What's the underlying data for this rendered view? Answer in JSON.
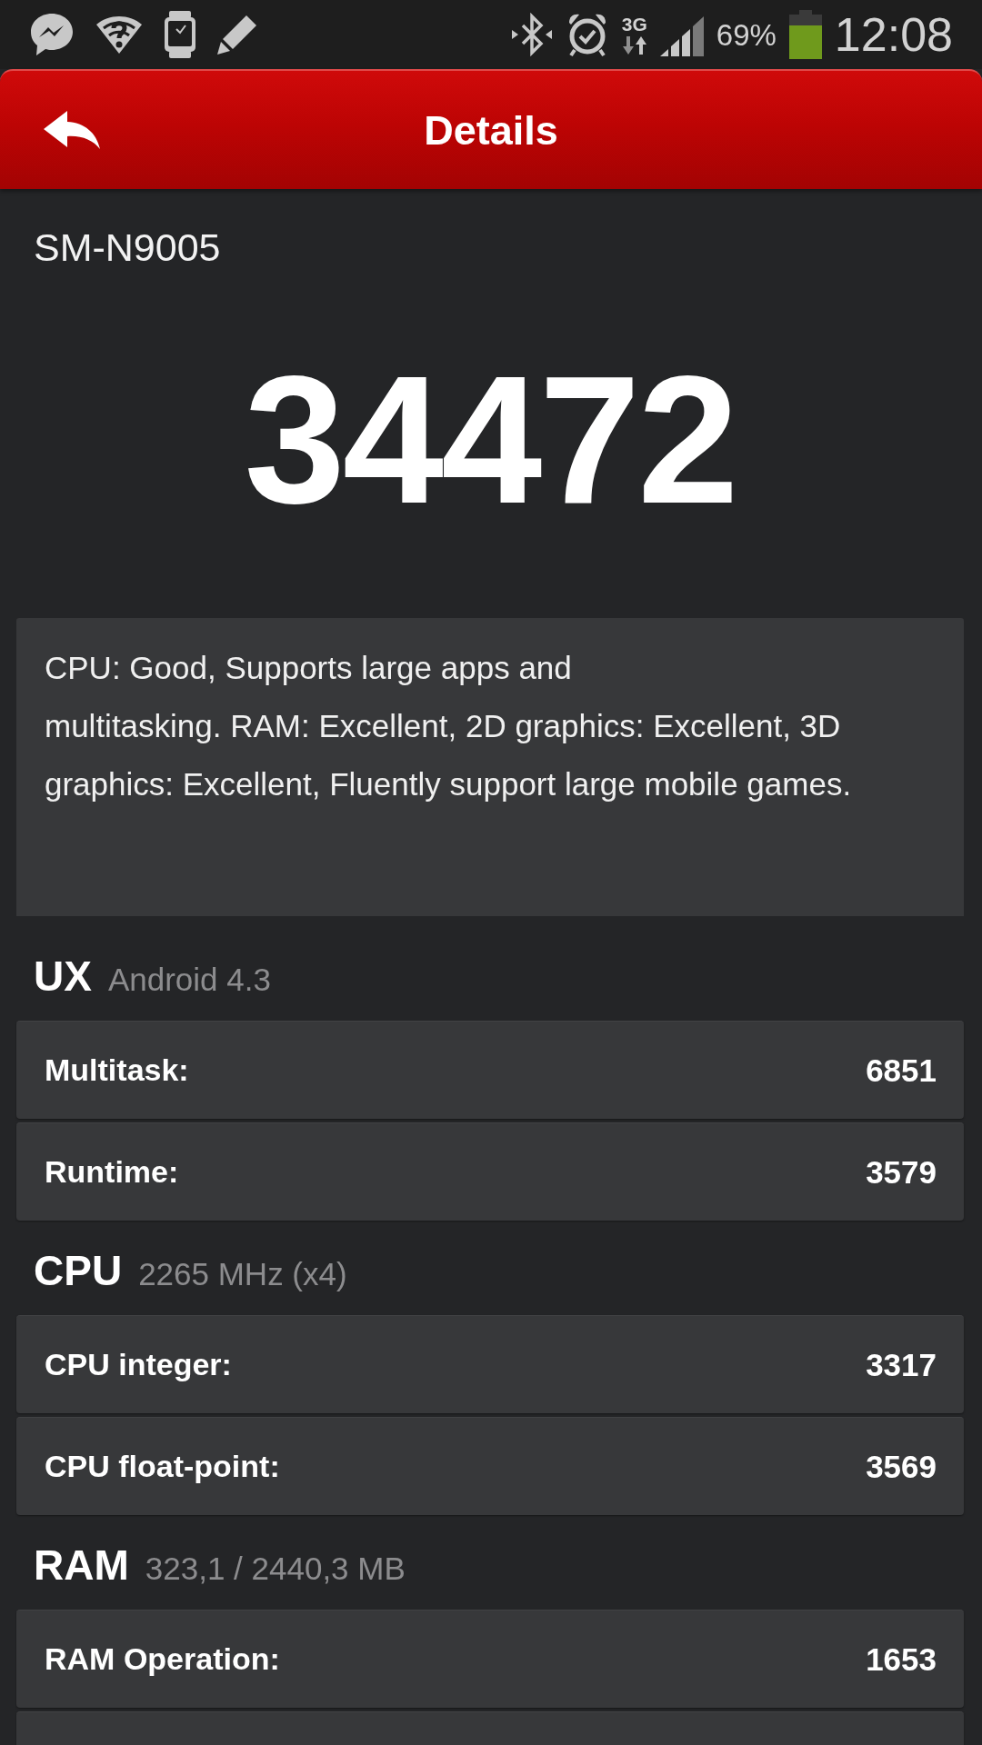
{
  "status_bar": {
    "network_type": "3G",
    "battery_percent": "69%",
    "time": "12:08"
  },
  "header": {
    "title": "Details"
  },
  "device": {
    "model": "SM-N9005",
    "score": "34472",
    "description": "CPU: Good, Supports large apps and\nmultitasking. RAM: Excellent, 2D graphics: Excellent, 3D\ngraphics: Excellent, Fluently support large mobile games."
  },
  "sections": [
    {
      "title": "UX",
      "subtitle": "Android 4.3",
      "rows": [
        {
          "label": "Multitask:",
          "value": "6851"
        },
        {
          "label": "Runtime:",
          "value": "3579"
        }
      ]
    },
    {
      "title": "CPU",
      "subtitle": "2265 MHz (x4)",
      "rows": [
        {
          "label": "CPU integer:",
          "value": "3317"
        },
        {
          "label": "CPU float-point:",
          "value": "3569"
        }
      ]
    },
    {
      "title": "RAM",
      "subtitle": "323,1 / 2440,3 MB",
      "rows": [
        {
          "label": "RAM Operation:",
          "value": "1653"
        }
      ]
    }
  ]
}
